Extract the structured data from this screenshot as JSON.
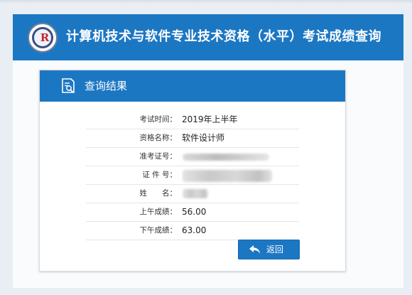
{
  "site": {
    "title": "计算机技术与软件专业技术资格（水平）考试成绩查询",
    "logo_letter": "R"
  },
  "result": {
    "heading": "查询结果",
    "rows": [
      {
        "label": "考试时间：",
        "value": "2019年上半年"
      },
      {
        "label": "资格名称：",
        "value": "软件设计师"
      },
      {
        "label": "准考证号：",
        "value": ""
      },
      {
        "label": "证 件 号：",
        "value": ""
      },
      {
        "label": "姓　　名：",
        "value": ""
      },
      {
        "label": "上午成绩：",
        "value": "56.00"
      },
      {
        "label": "下午成绩：",
        "value": "63.00"
      }
    ],
    "back_label": "返回"
  },
  "colors": {
    "brand_blue": "#1c77c3",
    "page_bg": "#e9eef4"
  },
  "icons": {
    "logo": "exam-logo-icon",
    "card": "search-document-icon",
    "back": "back-arrow-icon"
  }
}
